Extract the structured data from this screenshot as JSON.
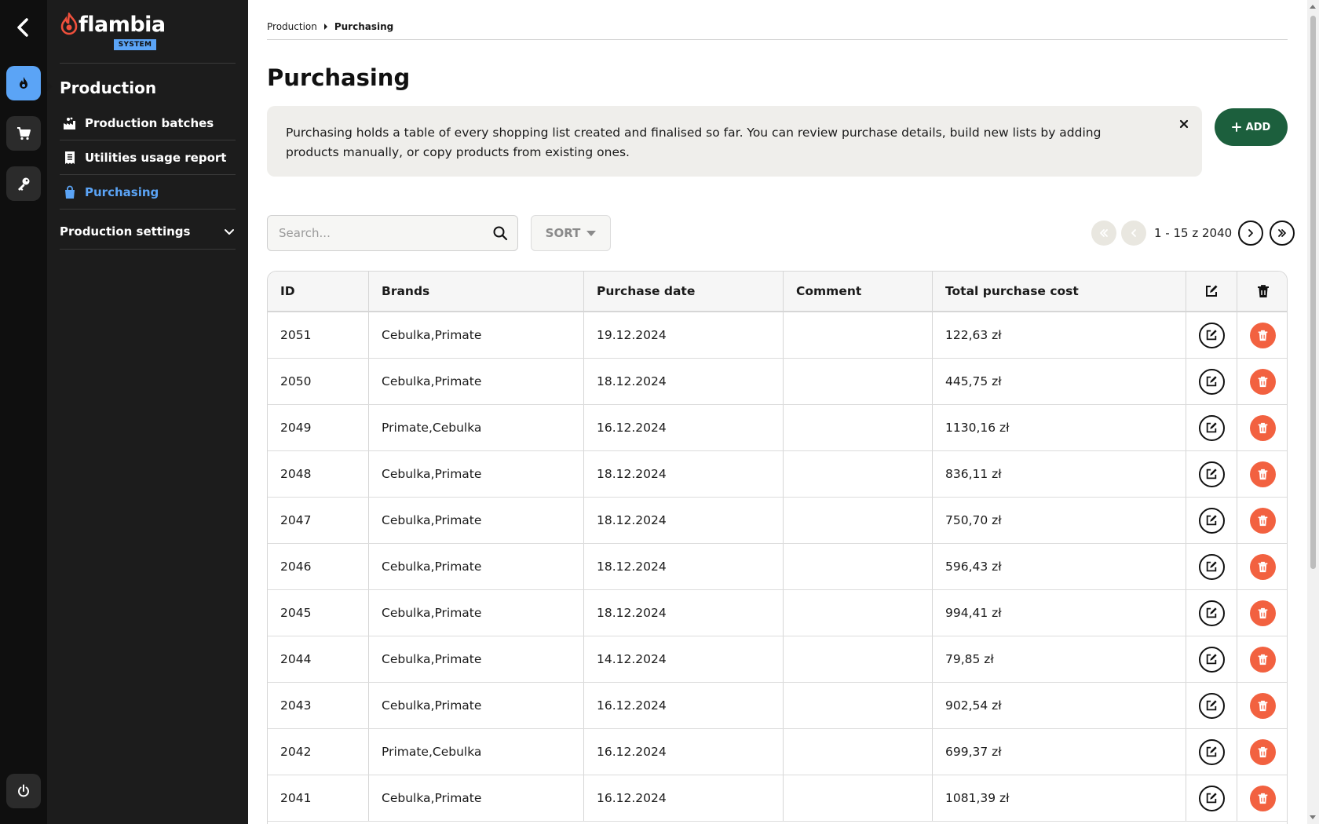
{
  "brand": {
    "name": "flambia",
    "badge": "SYSTEM"
  },
  "sidebar": {
    "section_title": "Production",
    "items": [
      {
        "label": "Production batches",
        "icon": "factory-icon"
      },
      {
        "label": "Utilities usage report",
        "icon": "receipt-icon"
      },
      {
        "label": "Purchasing",
        "icon": "shopping-bag-icon",
        "active": true
      }
    ],
    "settings_label": "Production settings"
  },
  "rail": {
    "items": [
      "flame-icon",
      "cart-icon",
      "key-icon"
    ],
    "bottom": "power-icon"
  },
  "breadcrumb": {
    "parent": "Production",
    "current": "Purchasing"
  },
  "page_title": "Purchasing",
  "info_text": "Purchasing holds a table of every shopping list created and finalised so far. You can review purchase details, build new lists by adding products manually, or copy products from existing ones.",
  "add_label": "ADD",
  "search": {
    "placeholder": "Search..."
  },
  "sort_label": "SORT",
  "pagination": {
    "range": "1 - 15 z 2040"
  },
  "table": {
    "headers": {
      "id": "ID",
      "brands": "Brands",
      "date": "Purchase date",
      "comment": "Comment",
      "total": "Total purchase cost"
    },
    "rows": [
      {
        "id": "2051",
        "brands": "Cebulka,Primate",
        "date": "19.12.2024",
        "comment": "",
        "total": "122,63 zł"
      },
      {
        "id": "2050",
        "brands": "Cebulka,Primate",
        "date": "18.12.2024",
        "comment": "",
        "total": "445,75 zł"
      },
      {
        "id": "2049",
        "brands": "Primate,Cebulka",
        "date": "16.12.2024",
        "comment": "",
        "total": "1130,16 zł"
      },
      {
        "id": "2048",
        "brands": "Cebulka,Primate",
        "date": "18.12.2024",
        "comment": "",
        "total": "836,11 zł"
      },
      {
        "id": "2047",
        "brands": "Cebulka,Primate",
        "date": "18.12.2024",
        "comment": "",
        "total": "750,70 zł"
      },
      {
        "id": "2046",
        "brands": "Cebulka,Primate",
        "date": "18.12.2024",
        "comment": "",
        "total": "596,43 zł"
      },
      {
        "id": "2045",
        "brands": "Cebulka,Primate",
        "date": "18.12.2024",
        "comment": "",
        "total": "994,41 zł"
      },
      {
        "id": "2044",
        "brands": "Cebulka,Primate",
        "date": "14.12.2024",
        "comment": "",
        "total": "79,85 zł"
      },
      {
        "id": "2043",
        "brands": "Cebulka,Primate",
        "date": "16.12.2024",
        "comment": "",
        "total": "902,54 zł"
      },
      {
        "id": "2042",
        "brands": "Primate,Cebulka",
        "date": "16.12.2024",
        "comment": "",
        "total": "699,37 zł"
      },
      {
        "id": "2041",
        "brands": "Cebulka,Primate",
        "date": "16.12.2024",
        "comment": "",
        "total": "1081,39 zł"
      }
    ]
  },
  "colors": {
    "accent": "#5ba4f6",
    "add_button": "#1c5f3d",
    "delete": "#f26140",
    "sidebar": "#1c1c1c",
    "rail": "#0f0f0f"
  }
}
